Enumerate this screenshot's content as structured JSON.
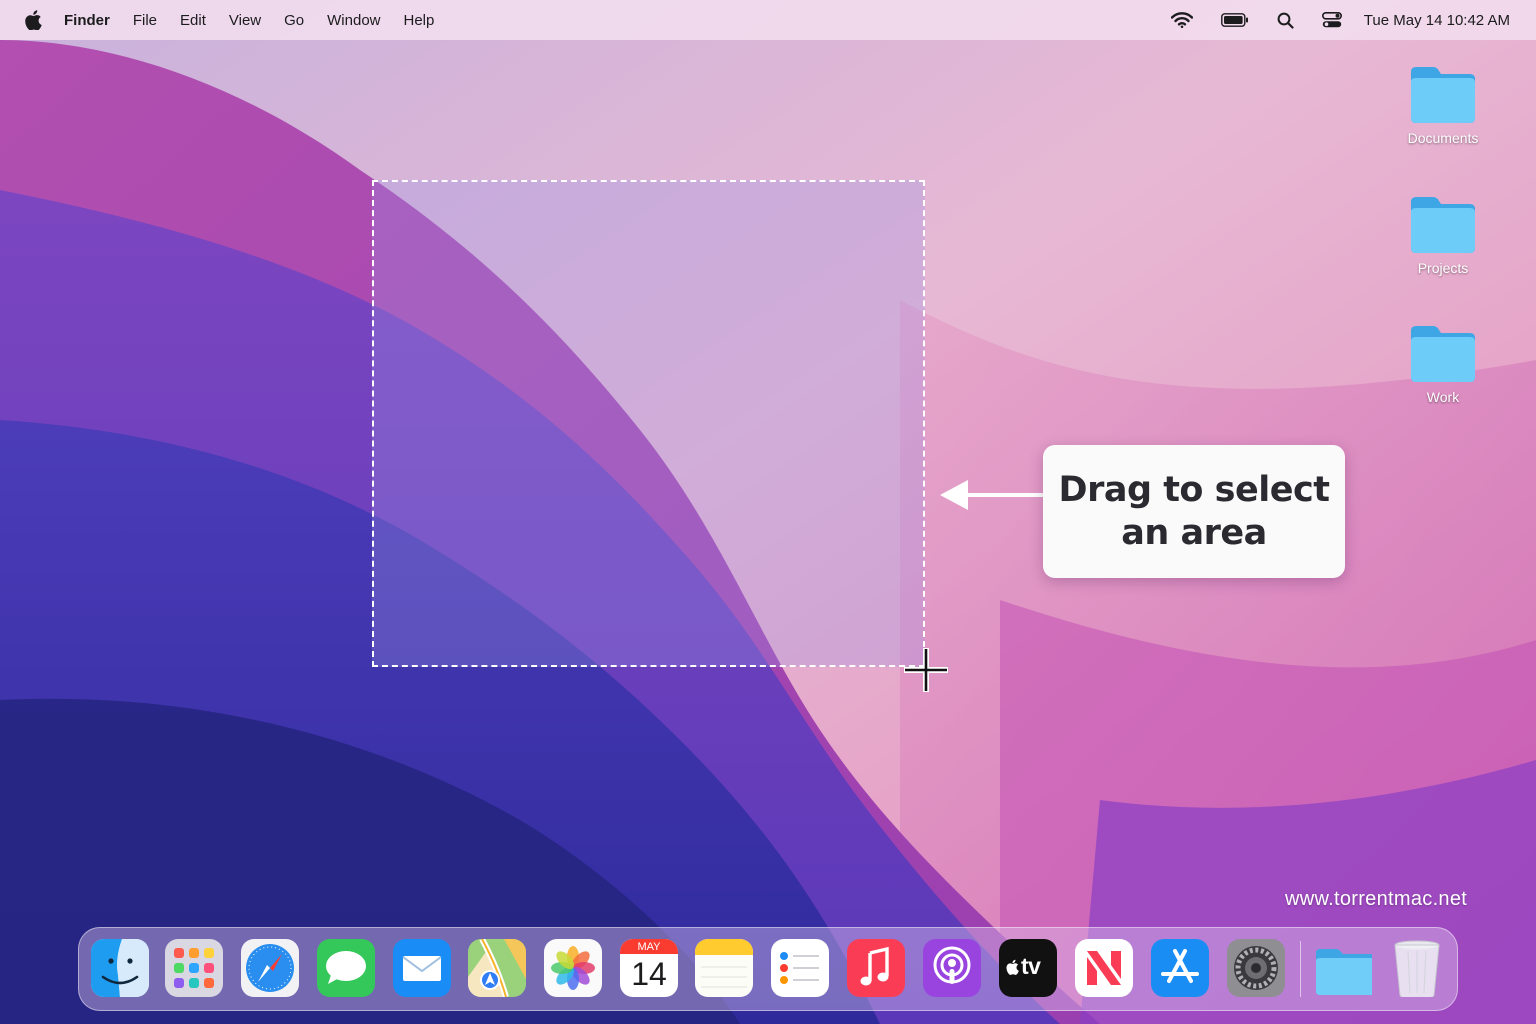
{
  "menubar": {
    "apple_icon": "apple-logo-icon",
    "app_name": "Finder",
    "menus": [
      "File",
      "Edit",
      "View",
      "Go",
      "Window",
      "Help"
    ],
    "status_icons": [
      "wifi-icon",
      "battery-icon",
      "spotlight-search-icon",
      "control-center-icon"
    ],
    "clock": "Tue May 14  10:42 AM"
  },
  "desktop": {
    "folders": [
      {
        "label": "Documents",
        "icon": "folder-icon"
      },
      {
        "label": "Projects",
        "icon": "folder-icon"
      },
      {
        "label": "Work",
        "icon": "folder-icon"
      }
    ]
  },
  "selection": {
    "border_style": "dashed white",
    "cursor_icon": "crosshair-icon"
  },
  "callout": {
    "line1": "Drag to select",
    "line2": "an area"
  },
  "watermark": "www.torrentmac.net",
  "dock": {
    "apps": [
      "Finder",
      "Launchpad",
      "Safari",
      "Messages",
      "Mail",
      "Maps",
      "Photos",
      "Calendar",
      "Notes",
      "Reminders",
      "Music",
      "Podcasts",
      "TV",
      "News",
      "App Store",
      "System Preferences"
    ],
    "calendar": {
      "month": "MAY",
      "day": "14"
    },
    "tv_label": "tv",
    "extras": [
      "Downloads folder",
      "Trash"
    ]
  },
  "colors": {
    "menubar_bg": "#f2deee",
    "selection_fill": "#a096e6",
    "callout_bg": "#fbfafb",
    "folder_blue": "#5ec6f5"
  }
}
